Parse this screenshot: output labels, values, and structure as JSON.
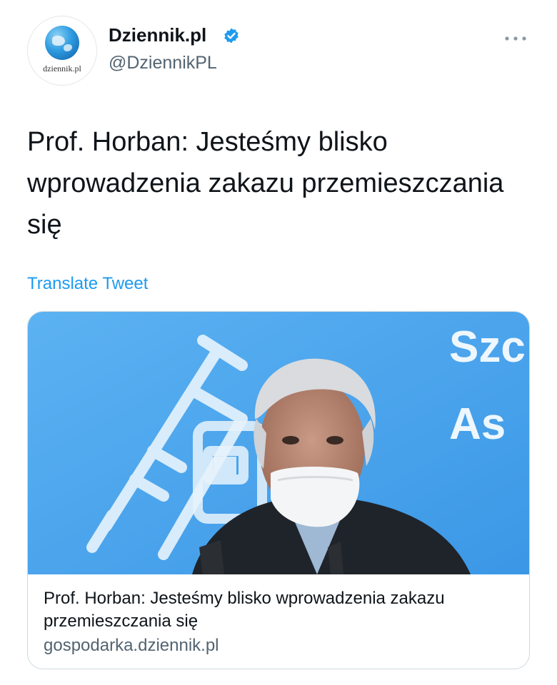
{
  "account": {
    "name": "Dziennik.pl",
    "handle": "@DziennikPL",
    "avatar_wordmark": "dziennik.pl",
    "verified": true
  },
  "tweet": {
    "text": "Prof. Horban: Jesteśmy blisko wprowadzenia zakazu przemieszczania się",
    "translate_label": "Translate Tweet"
  },
  "card": {
    "title": "Prof. Horban: Jesteśmy blisko wprowadzenia zakazu przemieszczania się",
    "domain": "gospodarka.dziennik.pl",
    "image_backdrop_text": [
      "Szc",
      "As"
    ]
  },
  "icons": {
    "verified": "verified-badge-icon",
    "more": "more-options-icon"
  },
  "colors": {
    "accent": "#1d9bf0",
    "text_primary": "#0f1419",
    "text_secondary": "#536471",
    "card_border": "#cfd9de",
    "image_backdrop": "#4aa6ee"
  }
}
